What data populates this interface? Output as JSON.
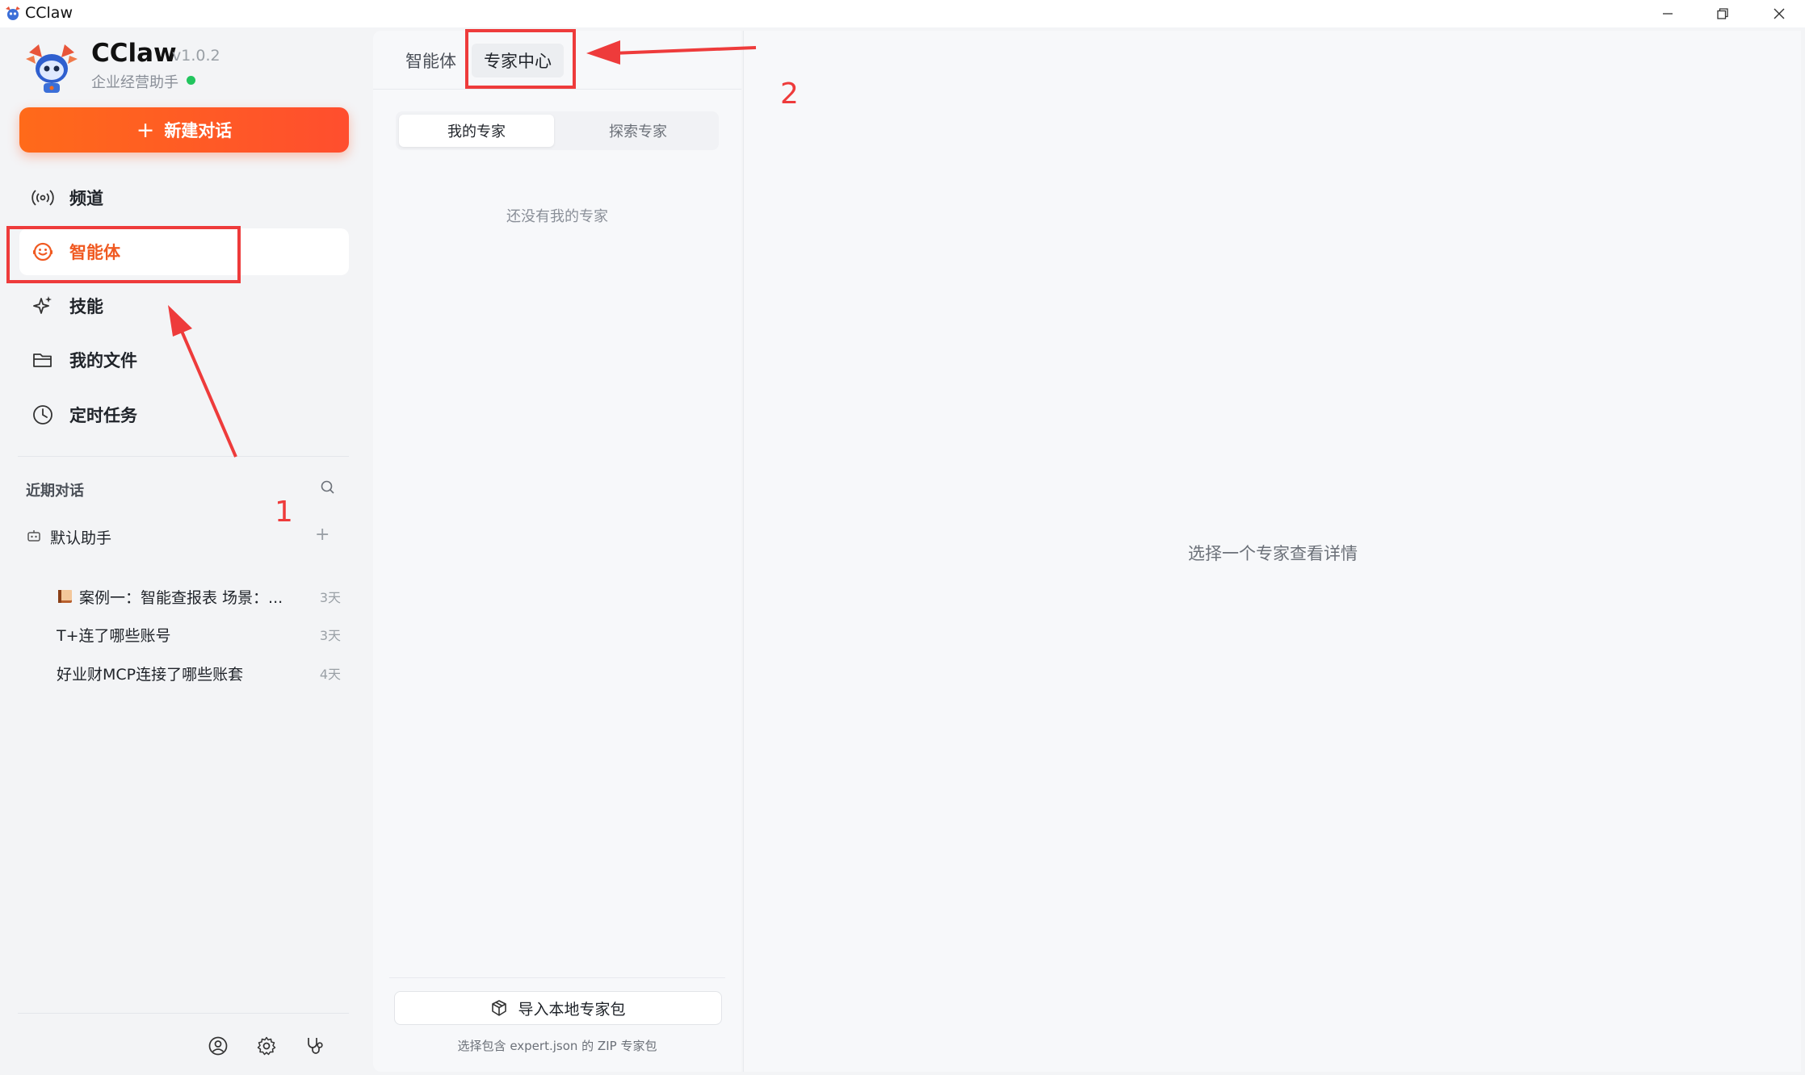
{
  "window": {
    "title": "CClaw"
  },
  "brand": {
    "name": "CClaw",
    "version": "v1.0.2",
    "subtitle": "企业经营助手",
    "status_color": "#22c55e",
    "accent_color": "#f05a22"
  },
  "sidebar": {
    "new_chat_label": "新建对话",
    "nav": [
      {
        "label": "频道",
        "icon": "broadcast-icon"
      },
      {
        "label": "智能体",
        "icon": "agent-icon",
        "active": true
      },
      {
        "label": "技能",
        "icon": "sparkle-icon"
      },
      {
        "label": "我的文件",
        "icon": "folder-icon"
      },
      {
        "label": "定时任务",
        "icon": "clock-icon"
      }
    ],
    "recent": {
      "title": "近期对话",
      "group": {
        "label": "默认助手",
        "icon": "bot-icon"
      },
      "items": [
        {
          "title": "案例一：智能查报表 场景：...",
          "time": "3天",
          "icon": "book-icon"
        },
        {
          "title": "T+连了哪些账号",
          "time": "3天"
        },
        {
          "title": "好业财MCP连接了哪些账套",
          "time": "4天"
        }
      ]
    },
    "footer_icons": [
      "user-icon",
      "settings-icon",
      "stethoscope-icon"
    ]
  },
  "middle": {
    "tabs": [
      {
        "label": "智能体"
      },
      {
        "label": "专家中心",
        "active": true
      }
    ],
    "segments": [
      {
        "label": "我的专家",
        "active": true
      },
      {
        "label": "探索专家"
      }
    ],
    "empty_text": "还没有我的专家",
    "import_label": "导入本地专家包",
    "import_hint": "选择包含 expert.json 的 ZIP 专家包"
  },
  "right": {
    "empty_text": "选择一个专家查看详情"
  },
  "annotations": [
    {
      "number": "1",
      "color": "#ee3b3b"
    },
    {
      "number": "2",
      "color": "#ee3b3b"
    }
  ]
}
